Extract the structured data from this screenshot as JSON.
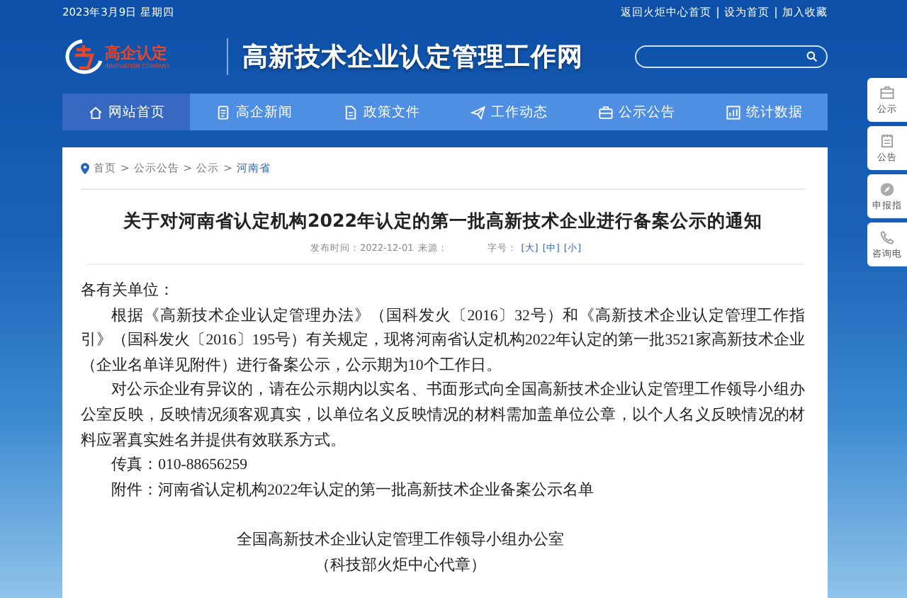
{
  "top_bar": {
    "date": "2023年3月9日 星期四",
    "links": [
      "返回火炬中心首页",
      "设为首页",
      "加入收藏"
    ]
  },
  "header": {
    "logo": {
      "text": "高企认定",
      "subtitle": "INNOVATION COMPANY"
    },
    "site_title": "高新技术企业认定管理工作网"
  },
  "nav": [
    {
      "label": "网站首页",
      "selected": true
    },
    {
      "label": "高企新闻",
      "selected": false
    },
    {
      "label": "政策文件",
      "selected": false
    },
    {
      "label": "工作动态",
      "selected": false
    },
    {
      "label": "公示公告",
      "selected": false
    },
    {
      "label": "统计数据",
      "selected": false
    }
  ],
  "side_dock": [
    "公示",
    "公告",
    "申报指",
    "咨询电"
  ],
  "article": {
    "breadcrumb_separator": ">",
    "breadcrumb": [
      {
        "label": "首页",
        "current": false
      },
      {
        "label": "公示公告",
        "current": false
      },
      {
        "label": "公示",
        "current": false
      },
      {
        "label": "河南省",
        "current": true
      }
    ],
    "title": "关于对河南省认定机构2022年认定的第一批高新技术企业进行备案公示的通知",
    "meta": {
      "published": "发布时间：2022-12-01",
      "source": "来源：",
      "font_size_label": "字号：",
      "sizes": [
        "[大]",
        "[中]",
        "[小]"
      ]
    },
    "paragraphs": [
      {
        "kind": "plain",
        "text": "各有关单位："
      },
      {
        "kind": "indent",
        "text": "根据《高新技术企业认定管理办法》（国科发火〔2016〕32号）和《高新技术企业认定管理工作指引》（国科发火〔2016〕195号）有关规定，现将河南省认定机构2022年认定的第一批3521家高新技术企业（企业名单详见附件）进行备案公示，公示期为10个工作日。"
      },
      {
        "kind": "indent",
        "text": "对公示企业有异议的，请在公示期内以实名、书面形式向全国高新技术企业认定管理工作领导小组办公室反映，反映情况须客观真实，以单位名义反映情况的材料需加盖单位公章，以个人名义反映情况的材料应署真实姓名并提供有效联系方式。"
      },
      {
        "kind": "indent",
        "text": "传真：010-88656259"
      },
      {
        "kind": "indent",
        "text": "附件：河南省认定机构2022年认定的第一批高新技术企业备案公示名单"
      },
      {
        "kind": "gap"
      },
      {
        "kind": "signature",
        "text": "全国高新技术企业认定管理工作领导小组办公室"
      },
      {
        "kind": "signature",
        "text": "（科技部火炬中心代章）"
      }
    ]
  }
}
